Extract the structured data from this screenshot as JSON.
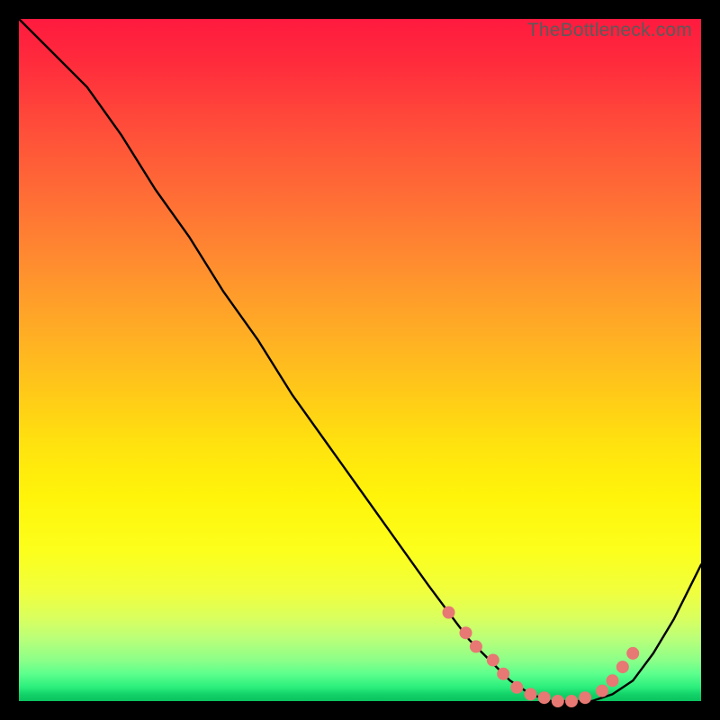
{
  "watermark": "TheBottleneck.com",
  "chart_data": {
    "type": "line",
    "title": "",
    "xlabel": "",
    "ylabel": "",
    "x_range": [
      0,
      100
    ],
    "y_range": [
      0,
      100
    ],
    "series": [
      {
        "name": "bottleneck-curve",
        "x": [
          0,
          5,
          10,
          15,
          20,
          25,
          30,
          35,
          40,
          45,
          50,
          55,
          60,
          63,
          66,
          69,
          72,
          75,
          78,
          81,
          84,
          87,
          90,
          93,
          96,
          100
        ],
        "y": [
          100,
          95,
          90,
          83,
          75,
          68,
          60,
          53,
          45,
          38,
          31,
          24,
          17,
          13,
          9,
          6,
          3,
          1,
          0,
          0,
          0,
          1,
          3,
          7,
          12,
          20
        ]
      }
    ],
    "markers": {
      "name": "highlight-dots",
      "x": [
        63,
        65.5,
        67,
        69.5,
        71,
        73,
        75,
        77,
        79,
        81,
        83,
        85.5,
        87,
        88.5,
        90
      ],
      "y": [
        13,
        10,
        8,
        6,
        4,
        2,
        1,
        0.5,
        0,
        0,
        0.5,
        1.5,
        3,
        5,
        7
      ]
    },
    "note": "x/y are percentage of plot-area width/height; y=0 is bottom edge. Values estimated from pixels; no axes/ticks rendered in source image."
  }
}
